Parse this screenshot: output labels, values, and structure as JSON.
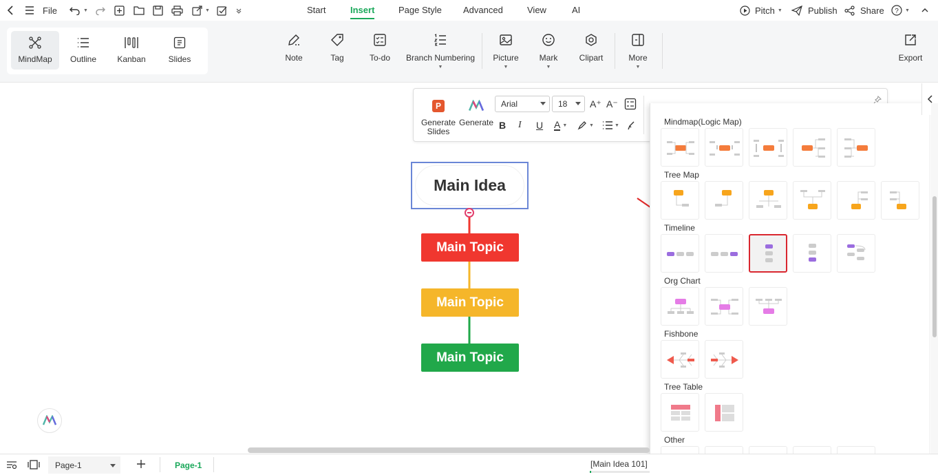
{
  "topbar": {
    "file_label": "File",
    "tabs": [
      {
        "label": "Start",
        "active": false
      },
      {
        "label": "Insert",
        "active": true
      },
      {
        "label": "Page Style",
        "active": false
      },
      {
        "label": "Advanced",
        "active": false
      },
      {
        "label": "View",
        "active": false
      },
      {
        "label": "AI",
        "active": false
      }
    ],
    "pitch_label": "Pitch",
    "publish_label": "Publish",
    "share_label": "Share"
  },
  "ribbon": {
    "views": [
      {
        "label": "MindMap",
        "active": true
      },
      {
        "label": "Outline",
        "active": false
      },
      {
        "label": "Kanban",
        "active": false
      },
      {
        "label": "Slides",
        "active": false
      }
    ],
    "items": [
      {
        "label": "Note"
      },
      {
        "label": "Tag"
      },
      {
        "label": "To-do"
      },
      {
        "label": "Branch Numbering"
      },
      {
        "label": "Picture"
      },
      {
        "label": "Mark"
      },
      {
        "label": "Clipart"
      },
      {
        "label": "More"
      }
    ],
    "export_label": "Export"
  },
  "floating_toolbar": {
    "generate_slides_label": "Generate Slides",
    "generate_label": "Generate",
    "font_family": "Arial",
    "font_size": "18",
    "font_grow_label": "A⁺",
    "font_shrink_label": "A⁻",
    "bold_label": "B",
    "italic_label": "I",
    "underline_label": "U",
    "font_color_label": "A"
  },
  "mindmap": {
    "main_idea": "Main Idea",
    "topics": [
      {
        "label": "Main Topic",
        "color": "#f0372f"
      },
      {
        "label": "Main Topic",
        "color": "#f5b62a"
      },
      {
        "label": "Main Topic",
        "color": "#21a84a"
      }
    ]
  },
  "layout_panel": {
    "sections": [
      {
        "title": "Mindmap(Logic Map)",
        "count": 5
      },
      {
        "title": "Tree Map",
        "count": 6
      },
      {
        "title": "Timeline",
        "count": 5,
        "selected_index": 2
      },
      {
        "title": "Org Chart",
        "count": 3
      },
      {
        "title": "Fishbone",
        "count": 2
      },
      {
        "title": "Tree Table",
        "count": 2
      },
      {
        "title": "Other",
        "count": 5
      }
    ]
  },
  "statusbar": {
    "page_select": "Page-1",
    "page_tab": "Page-1",
    "selection_info": "[Main Idea 101]"
  },
  "colors": {
    "accent": "#1aa85a",
    "selection_border": "#6a86d6",
    "highlight_red": "#d9262e"
  }
}
